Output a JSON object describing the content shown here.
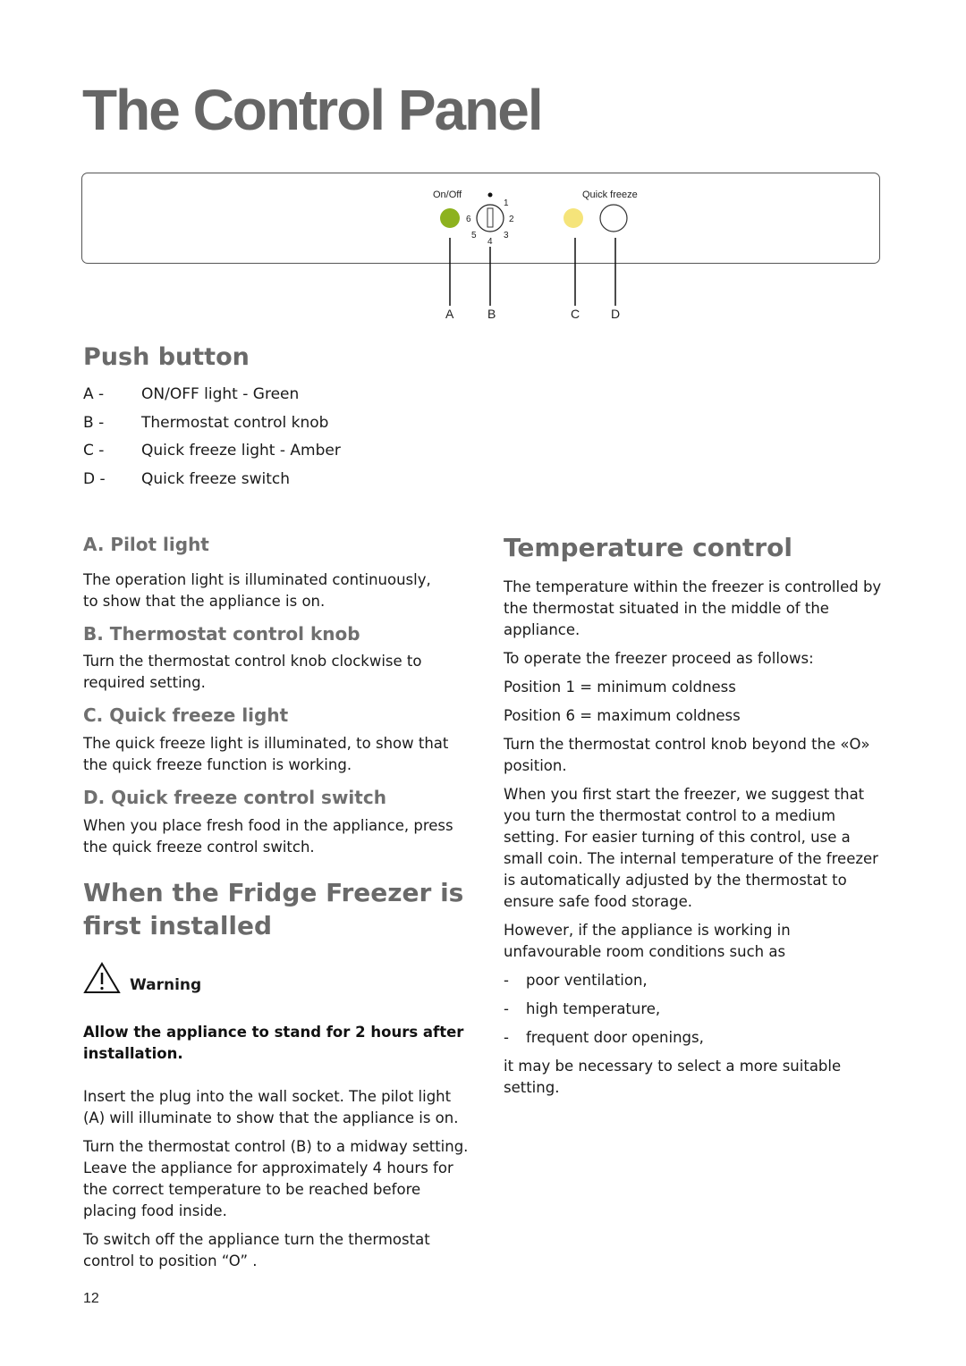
{
  "page": {
    "title": "The Control Panel",
    "page_number": "12"
  },
  "diagram": {
    "labels": {
      "on_off": "On/Off",
      "quick_freeze": "Quick freeze"
    },
    "knob_positions": [
      "1",
      "2",
      "3",
      "4",
      "5",
      "6"
    ],
    "callouts": [
      "A",
      "B",
      "C",
      "D"
    ],
    "colors": {
      "on_off_light": "#8db21e",
      "quick_freeze_light": "#f5e47a"
    }
  },
  "push_button": {
    "heading": "Push button",
    "items": [
      {
        "key": "A -",
        "label": "ON/OFF light - Green"
      },
      {
        "key": "B -",
        "label": "Thermostat control knob"
      },
      {
        "key": "C -",
        "label": "Quick freeze light - Amber"
      },
      {
        "key": "D -",
        "label": "Quick freeze switch"
      }
    ]
  },
  "left_sections": [
    {
      "heading": "A. Pilot light",
      "text": "The operation light is illuminated continuously, to show that the appliance is on."
    },
    {
      "heading": "B. Thermostat control knob",
      "text": "Turn the thermostat control knob clockwise to required setting."
    },
    {
      "heading": "C. Quick freeze light",
      "text": "The quick freeze light is illuminated, to show that the quick freeze function is working."
    },
    {
      "heading": "D. Quick freeze control switch",
      "text": "When you place fresh food in the appliance, press the quick freeze control switch."
    }
  ],
  "first_installed": {
    "heading": "When the Fridge Freezer is first installed",
    "warning_label": "Warning",
    "warning_text": "Allow the appliance to stand for 2 hours after installation.",
    "paragraphs": [
      "Insert the plug into the wall socket. The pilot light (A) will illuminate to show that the appliance is on.",
      "Turn the thermostat control (B) to a midway setting. Leave the appliance for approximately 4 hours for the correct temperature to be reached before placing food inside.",
      "To switch off the appliance turn the thermostat control to position “O” ."
    ]
  },
  "temperature_control": {
    "heading": "Temperature control",
    "paragraphs": [
      "The temperature within the freezer is controlled by the thermostat situated in the middle of the appliance.",
      "To operate the freezer proceed as follows:",
      "Position 1 = minimum coldness",
      "Position 6 = maximum coldness",
      "Turn the thermostat control knob beyond the «O» position.",
      "When you first start the freezer, we suggest that you turn the thermostat control to a medium setting. For easier turning of this control, use a small coin. The internal temperature of the freezer is automatically adjusted by the thermostat to ensure safe food storage.",
      "However, if the appliance is working in unfavourable room conditions such as"
    ],
    "bullets": [
      "poor ventilation,",
      "high temperature,",
      "frequent door openings,"
    ],
    "bullet_marker": "-",
    "closing": "it may be necessary to select a more suitable setting."
  }
}
